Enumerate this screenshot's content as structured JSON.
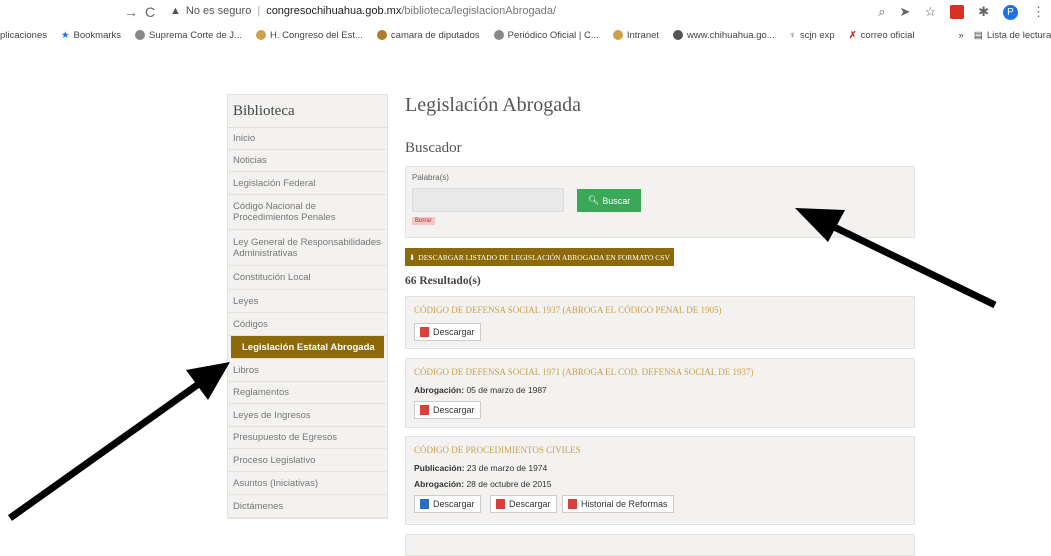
{
  "browser": {
    "insecure_label": "No es seguro",
    "domain": "congresochihuahua.gob.mx",
    "path": "/biblioteca/legislacionAbrogada/",
    "bookmarks": [
      "plicaciones",
      "Bookmarks",
      "Suprema Corte de J...",
      "H. Congreso del Est...",
      "camara de diputados",
      "Periódico Oficial | C...",
      "Intranet",
      "www.chihuahua.go...",
      "scjn exp",
      "correo oficial"
    ],
    "reading_list": "Lista de lectura",
    "profile_initial": "P"
  },
  "sidebar": {
    "title": "Biblioteca",
    "items": [
      "Inicio",
      "Noticias",
      "Legislación Federal",
      "Código Nacional de Procedimientos Penales",
      "Ley General de Responsabilidades Administrativas",
      "Constitución Local",
      "Leyes",
      "Códigos",
      "Legislación Estatal Abrogada",
      "Libros",
      "Reglamentos",
      "Leyes de Ingresos",
      "Presupuesto de Egresos",
      "Proceso Legislativo",
      "Asuntos (Iniciativas)",
      "Dictámenes"
    ],
    "active_index": 8
  },
  "main": {
    "title": "Legislación Abrogada",
    "search_heading": "Buscador",
    "search_label": "Palabra(s)",
    "search_value": "",
    "search_button": "Buscar",
    "clear_label": "Borrar",
    "csv_button": "DESCARGAR LISTADO DE LEGISLACIÓN ABROGADA EN FORMATO CSV",
    "results_count": "66 Resultado(s)"
  },
  "results": [
    {
      "title": "CÓDIGO DE DEFENSA SOCIAL 1937 (ABROGA EL CÓDIGO PENAL DE 1905)",
      "buttons": [
        "Descargar"
      ]
    },
    {
      "title": "CÓDIGO DE DEFENSA SOCIAL 1971 (ABROGA EL COD. DEFENSA SOCIAL DE 1937)",
      "abrogacion_label": "Abrogación:",
      "abrogacion": "05 de marzo de 1987",
      "buttons": [
        "Descargar"
      ]
    },
    {
      "title": "CÓDIGO DE PROCEDIMIENTOS CIVILES",
      "publicacion_label": "Publicación:",
      "publicacion": "23 de marzo de 1974",
      "abrogacion_label": "Abrogación:",
      "abrogacion": "28 de octubre de 2015",
      "buttons": [
        "Descargar",
        "Descargar",
        "Historial de Reformas"
      ]
    }
  ],
  "colors": {
    "accent": "#8d6a09",
    "search_button": "#3aa856",
    "card_title": "#c9a24a",
    "panel": "#f3f2f0"
  }
}
